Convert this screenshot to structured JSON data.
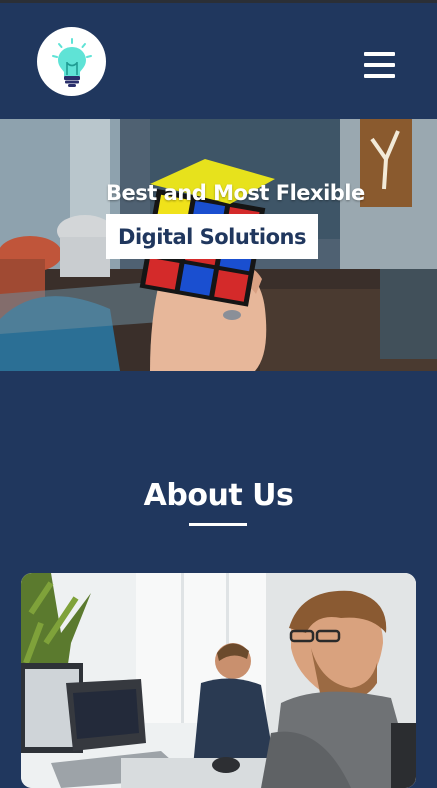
{
  "header": {
    "logo_icon": "lightbulb-icon",
    "menu_icon": "hamburger-menu-icon"
  },
  "hero": {
    "tagline": "Best and Most Flexible",
    "highlight": "Digital Solutions",
    "image": "hand-holding-rubiks-cube-photo"
  },
  "about": {
    "title": "About Us",
    "image": "office-workers-at-desks-photo"
  },
  "colors": {
    "brand_navy": "#20375e",
    "accent_teal": "#5fe3d6",
    "white": "#ffffff"
  }
}
